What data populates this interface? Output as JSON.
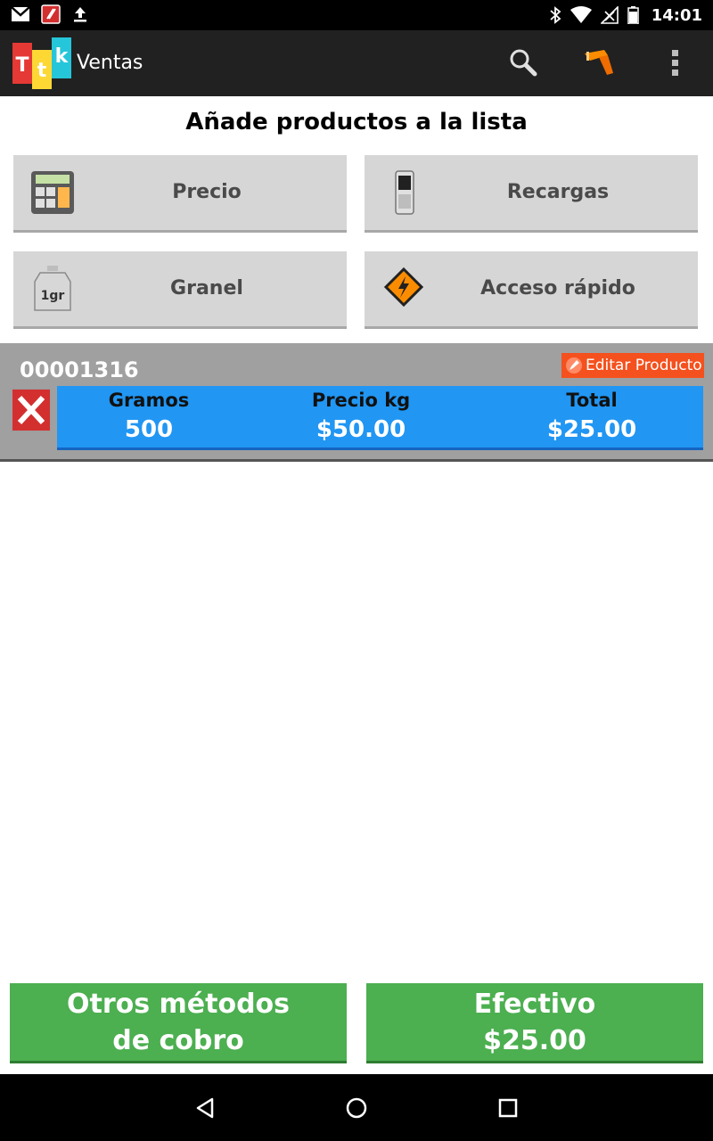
{
  "status_bar": {
    "time": "14:01",
    "left_icons": [
      "gmail-icon",
      "app-notification-icon",
      "upload-icon"
    ],
    "right_icons": [
      "bluetooth-icon",
      "wifi-icon",
      "signal-icon",
      "battery-icon"
    ]
  },
  "action_bar": {
    "logo_letters": [
      "T",
      "t",
      "k"
    ],
    "title": "Ventas",
    "actions": [
      "search-icon",
      "barcode-scanner-icon",
      "overflow-menu-icon"
    ]
  },
  "main": {
    "heading": "Añade productos a la lista",
    "buttons": [
      {
        "label": "Precio",
        "icon": "calculator-icon"
      },
      {
        "label": "Recargas",
        "icon": "cellphone-icon"
      },
      {
        "label": "Granel",
        "icon": "weight-icon"
      },
      {
        "label": "Acceso rápido",
        "icon": "lightning-icon"
      }
    ]
  },
  "product": {
    "code": "00001316",
    "edit_label": "Editar Producto",
    "columns": [
      {
        "header": "Gramos",
        "value": "500"
      },
      {
        "header": "Precio kg",
        "value": "$50.00"
      },
      {
        "header": "Total",
        "value": "$25.00"
      }
    ]
  },
  "footer": {
    "other_methods_line1": "Otros métodos",
    "other_methods_line2": "de cobro",
    "cash_line1": "Efectivo",
    "cash_line2": "$25.00"
  },
  "colors": {
    "action_bar": "#212121",
    "grid_button": "#d6d6d6",
    "info_panel": "#2196f3",
    "edit_button": "#f4511e",
    "delete_button": "#d32f2f",
    "pay_button": "#4caf50"
  }
}
